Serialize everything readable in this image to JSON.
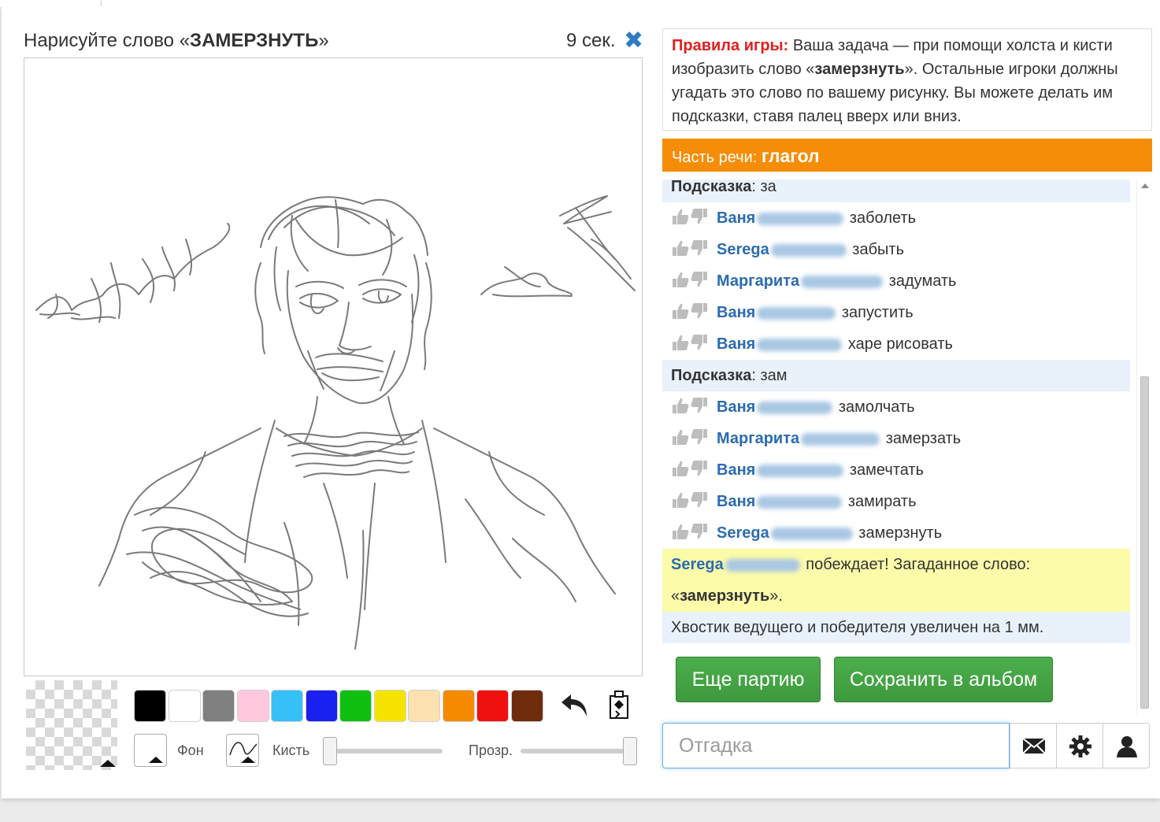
{
  "header": {
    "prompt_prefix": "Нарисуйте слово «",
    "prompt_word": "ЗАМЕРЗНУТЬ",
    "prompt_suffix": "»",
    "timer": "9 сек.",
    "close_icon": "close-icon"
  },
  "toolbar": {
    "colors": [
      "#000000",
      "#ffffff",
      "#808080",
      "#ffc8dd",
      "#36c0f7",
      "#1a21ef",
      "#10c010",
      "#f5e400",
      "#fde1b0",
      "#f58a00",
      "#f01010",
      "#6e2c0c"
    ],
    "undo_icon": "undo-icon",
    "clear_icon": "clear-canvas-icon",
    "background_label": "Фон",
    "brush_label": "Кисть",
    "opacity_label": "Прозр.",
    "brush_size": 0,
    "opacity": 1
  },
  "rules": {
    "label": "Правила игры:",
    "text_1": " Ваша задача — при помощи холста и кисти изобразить слово «",
    "word": "замерзнуть",
    "text_2": "». Остальные игроки должны угадать это слово по вашему рисунку. Вы можете делать им подсказки, ставя палец вверх или вниз."
  },
  "part_of_speech": {
    "label": "Часть речи:",
    "value": "глагол"
  },
  "chat": [
    {
      "type": "hint",
      "label": "Подсказка",
      "text": ": за"
    },
    {
      "type": "guess",
      "name": "Ваня",
      "text": "заболеть"
    },
    {
      "type": "guess",
      "name": "Serega",
      "text": "забыть"
    },
    {
      "type": "guess",
      "name": "Маргарита",
      "text": "задумать"
    },
    {
      "type": "guess",
      "name": "Ваня",
      "text": "запустить"
    },
    {
      "type": "guess",
      "name": "Ваня",
      "text": "харе рисовать"
    },
    {
      "type": "hint",
      "label": "Подсказка",
      "text": ": зам"
    },
    {
      "type": "guess",
      "name": "Ваня",
      "text": "замолчать"
    },
    {
      "type": "guess",
      "name": "Маргарита",
      "text": "замерзать"
    },
    {
      "type": "guess",
      "name": "Ваня",
      "text": "замечтать"
    },
    {
      "type": "guess",
      "name": "Ваня",
      "text": "замирать"
    },
    {
      "type": "guess",
      "name": "Serega",
      "text": "замерзнуть"
    }
  ],
  "win": {
    "name": "Serega",
    "text": " побеждает! Загаданное слово:",
    "quote_open": "«",
    "word": "замерзнуть",
    "quote_close": "».",
    "info": "Хвостик ведущего и победителя увеличен на 1 мм."
  },
  "buttons": {
    "again": "Еще партию",
    "save": "Сохранить в альбом"
  },
  "input": {
    "placeholder": "Отгадка",
    "value": ""
  },
  "icons": [
    "envelope-icon",
    "gear-icon",
    "user-icon"
  ]
}
